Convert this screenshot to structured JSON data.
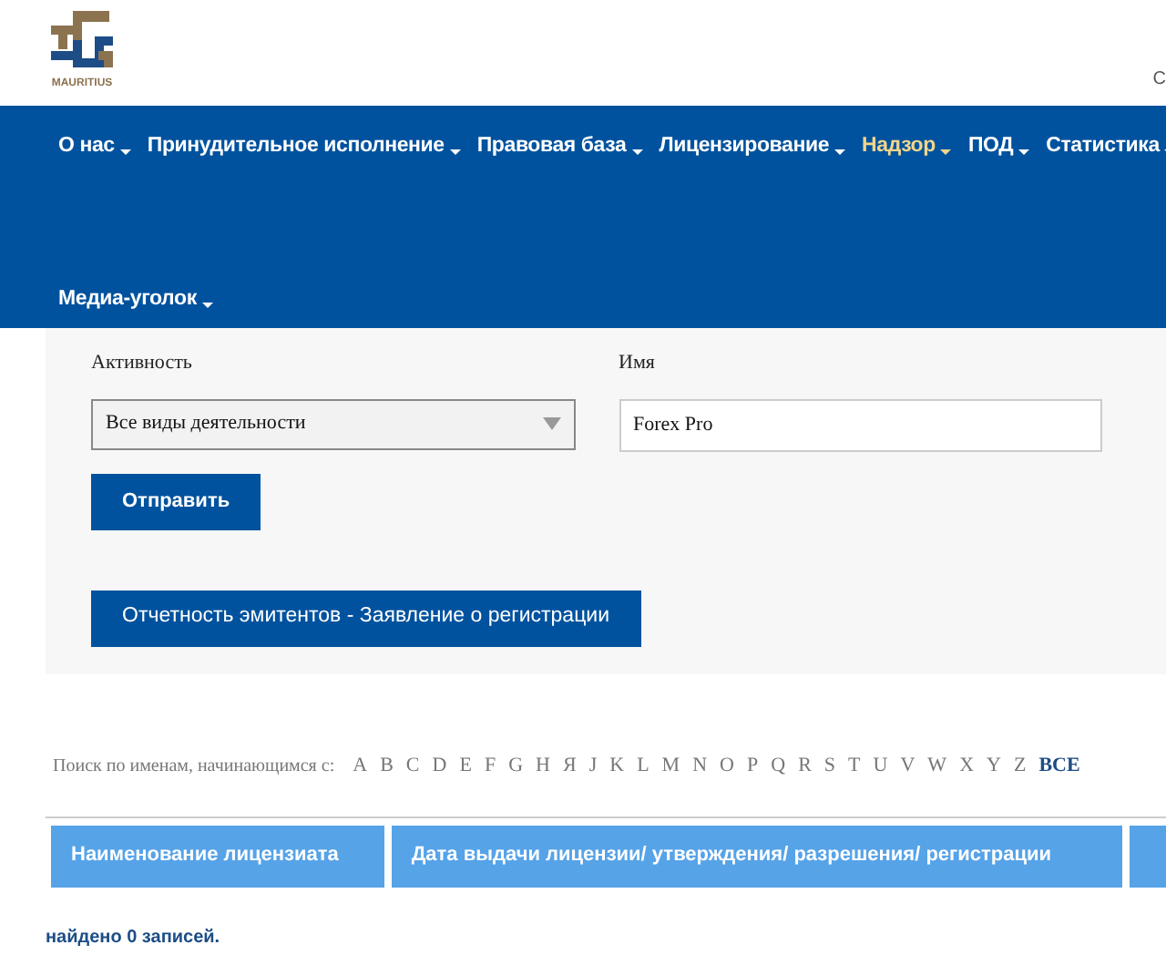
{
  "header": {
    "logo_text": "MAURITIUS",
    "corner_text": "С"
  },
  "nav": {
    "rows": [
      [
        {
          "label": "О нас",
          "selected": false
        },
        {
          "label": "Принудительное исполнение",
          "selected": false
        },
        {
          "label": "Правовая база",
          "selected": false
        },
        {
          "label": "Лицензирование",
          "selected": false
        },
        {
          "label": "Надзор",
          "selected": true
        },
        {
          "label": "ПОД",
          "selected": false
        },
        {
          "label": "Статистика",
          "selected": false
        }
      ],
      [
        {
          "label": "Медиа-уголок",
          "selected": false
        }
      ]
    ]
  },
  "filter": {
    "activity_label": "Активность",
    "activity_value": "Все виды деятельности",
    "name_label": "Имя",
    "name_value": "Forex Pro",
    "submit": "Отправить",
    "report_button": "Отчетность эмитентов - Заявление о регистрации"
  },
  "alphabet": {
    "label": "Поиск по именам, начинающимся с:",
    "letters": [
      {
        "text": "A",
        "selected": false
      },
      {
        "text": "B",
        "selected": false
      },
      {
        "text": "C",
        "selected": false
      },
      {
        "text": "D",
        "selected": false
      },
      {
        "text": "E",
        "selected": false
      },
      {
        "text": "F",
        "selected": false
      },
      {
        "text": "G",
        "selected": false
      },
      {
        "text": "H",
        "selected": false
      },
      {
        "text": "Я",
        "selected": false
      },
      {
        "text": "J",
        "selected": false
      },
      {
        "text": "K",
        "selected": false
      },
      {
        "text": "L",
        "selected": false
      },
      {
        "text": "M",
        "selected": false
      },
      {
        "text": "N",
        "selected": false
      },
      {
        "text": "O",
        "selected": false
      },
      {
        "text": "P",
        "selected": false
      },
      {
        "text": "Q",
        "selected": false
      },
      {
        "text": "R",
        "selected": false
      },
      {
        "text": "S",
        "selected": false
      },
      {
        "text": "T",
        "selected": false
      },
      {
        "text": "U",
        "selected": false
      },
      {
        "text": "V",
        "selected": false
      },
      {
        "text": "W",
        "selected": false
      },
      {
        "text": "X",
        "selected": false
      },
      {
        "text": "Y",
        "selected": false
      },
      {
        "text": "Z",
        "selected": false
      },
      {
        "text": "ВСЕ",
        "selected": true
      }
    ]
  },
  "table": {
    "columns": [
      "Наименование лицензиата",
      "Дата выдачи лицензии/ утверждения/ разрешения/ регистрации"
    ]
  },
  "status": "найдено 0 записей."
}
